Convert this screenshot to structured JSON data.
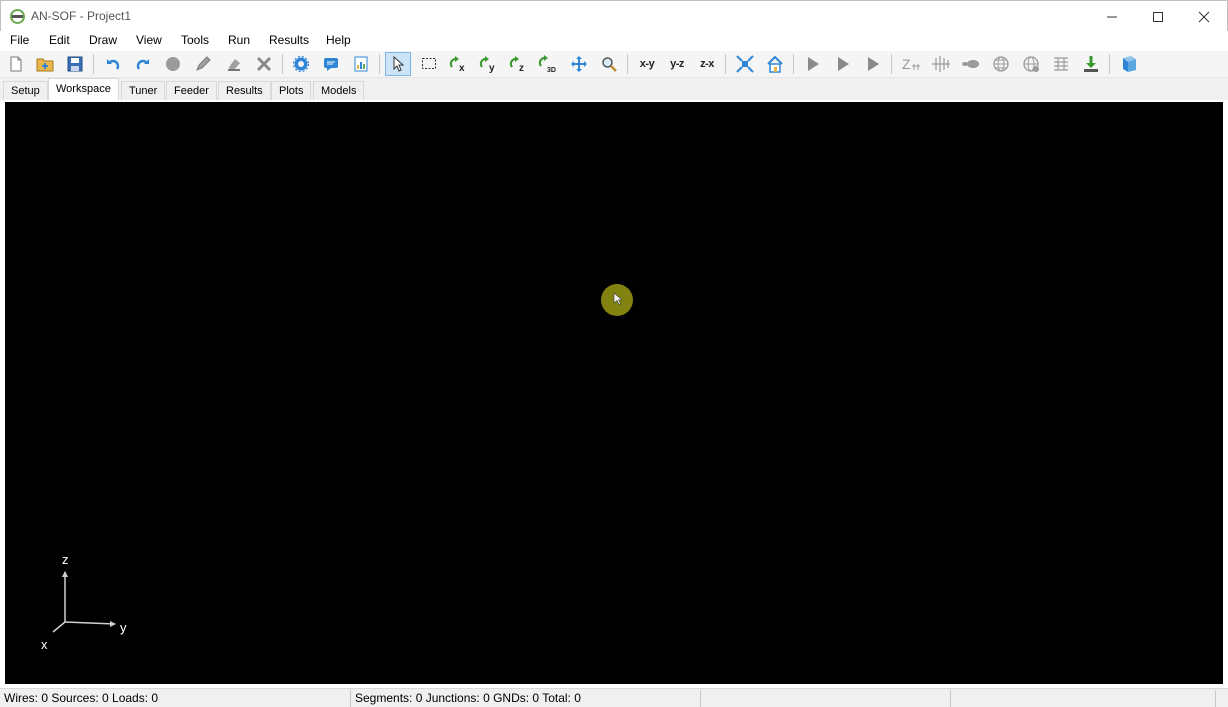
{
  "window": {
    "title": "AN-SOF - Project1"
  },
  "menu": [
    "File",
    "Edit",
    "Draw",
    "View",
    "Tools",
    "Run",
    "Results",
    "Help"
  ],
  "toolbar": {
    "view_xy": "x-y",
    "view_yz": "y-z",
    "view_zx": "z-x"
  },
  "tabs": [
    "Setup",
    "Workspace",
    "Tuner",
    "Feeder",
    "Results",
    "Plots",
    "Models"
  ],
  "selected_tab": "Workspace",
  "axes": {
    "z": "z",
    "y": "y",
    "x": "x"
  },
  "status": {
    "left": "Wires: 0  Sources: 0  Loads: 0",
    "middle": "Segments: 0  Junctions: 0  GNDs: 0  Total: 0"
  },
  "colors": {
    "workspace_bg": "#000000",
    "accent": "#2f86d6",
    "cursor_highlight": "#8a8a12"
  }
}
